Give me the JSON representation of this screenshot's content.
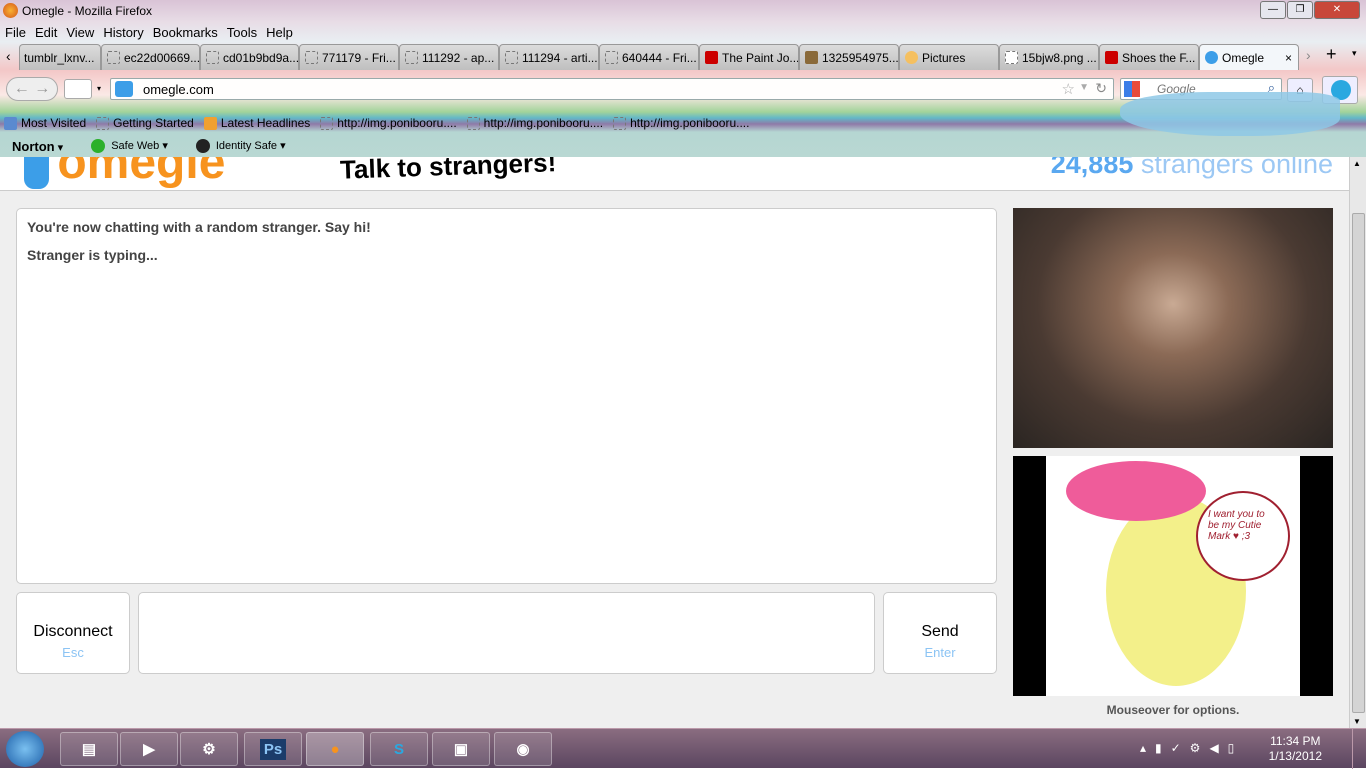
{
  "window": {
    "title": "Omegle - Mozilla Firefox"
  },
  "menu": [
    "File",
    "Edit",
    "View",
    "History",
    "Bookmarks",
    "Tools",
    "Help"
  ],
  "tabs": [
    "tumblr_lxnv...",
    "ec22d00669...",
    "cd01b9bd9a...",
    "771179 - Fri...",
    "111292 - ap...",
    "111294 - arti...",
    "640444 - Fri...",
    "The Paint Jo...",
    "1325954975...",
    "Pictures",
    "15bjw8.png ...",
    "Shoes the F...",
    "Omegle"
  ],
  "nav": {
    "url": "omegle.com",
    "search_placeholder": "Google"
  },
  "bookmarks": [
    "Most Visited",
    "Getting Started",
    "Latest Headlines",
    "http://img.ponibooru....",
    "http://img.ponibooru....",
    "http://img.ponibooru...."
  ],
  "norton": {
    "brand": "Norton",
    "safe_web": "Safe Web",
    "identity_safe": "Identity Safe"
  },
  "page": {
    "logo": "omegle",
    "tagline": "Talk to strangers!",
    "online_count": "24,885",
    "online_label": "strangers online",
    "messages": [
      "You're now chatting with a random stranger. Say hi!",
      "Stranger is typing..."
    ],
    "disconnect": "Disconnect",
    "disconnect_key": "Esc",
    "send": "Send",
    "send_key": "Enter",
    "chat_value": "",
    "mouseover": "Mouseover for options.",
    "speech": "I want you to be my Cutie Mark ♥ ;3"
  },
  "taskbar": {
    "time": "11:34 PM",
    "date": "1/13/2012",
    "apps": [
      "Explorer",
      "Media",
      "Steam",
      "Ps",
      "Firefox",
      "Skype",
      "Network",
      "Camera"
    ]
  }
}
